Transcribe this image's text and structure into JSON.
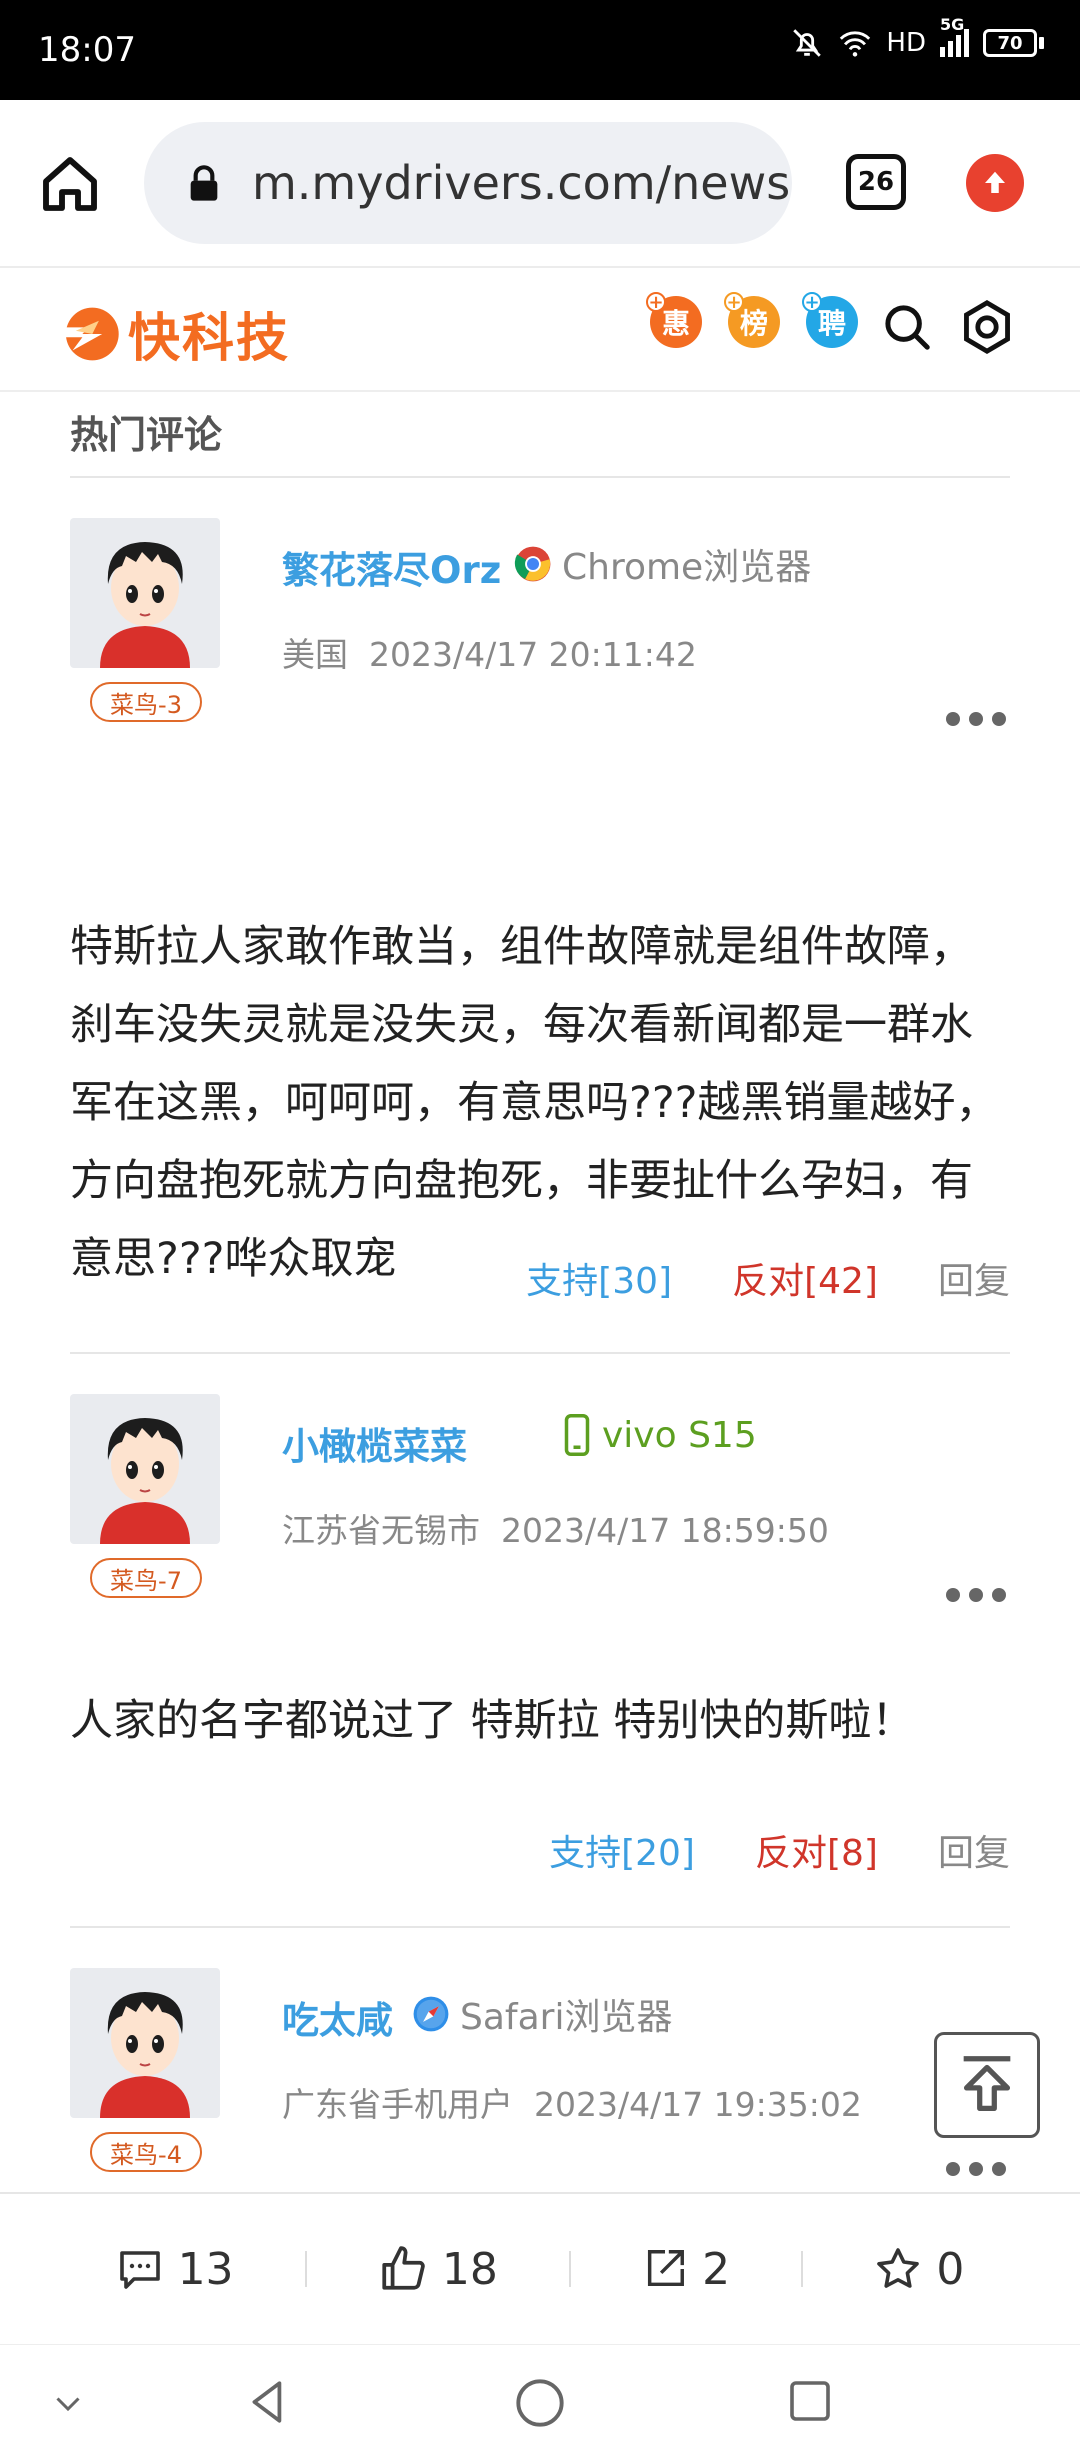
{
  "status_bar": {
    "time": "18:07",
    "network": "HD",
    "signal": "5G",
    "battery": "70"
  },
  "browser": {
    "url": "m.mydrivers.com/newsv",
    "tab_count": "26"
  },
  "site": {
    "logo_text": "快科技",
    "header_icons": [
      {
        "label": "惠",
        "color": "#f36c21",
        "icon": "deals-icon"
      },
      {
        "label": "榜",
        "color": "#f59a23",
        "icon": "ranking-icon"
      },
      {
        "label": "聘",
        "color": "#23a7e6",
        "icon": "jobs-icon"
      }
    ]
  },
  "section_title": "热门评论",
  "comments": [
    {
      "username": "繁花落尽Orz",
      "device": "Chrome浏览器",
      "device_icon": "chrome-icon",
      "location": "美国",
      "time": "2023/4/17 20:11:42",
      "level": "菜鸟-3",
      "text": "特斯拉人家敢作敢当，组件故障就是组件故障，刹车没失灵就是没失灵，每次看新闻都是一群水军在这黑，呵呵呵，有意思吗???越黑销量越好，方向盘抱死就方向盘抱死，非要扯什么孕妇，有意思???哗众取宠",
      "support": "支持[30]",
      "oppose": "反对[42]",
      "reply": "回复"
    },
    {
      "username": "小橄榄菜菜",
      "device": "vivo S15",
      "device_icon": "phone-icon",
      "location": "江苏省无锡市",
      "time": "2023/4/17 18:59:50",
      "level": "菜鸟-7",
      "text": "人家的名字都说过了 特斯拉 特别快的斯啦！",
      "support": "支持[20]",
      "oppose": "反对[8]",
      "reply": "回复"
    },
    {
      "username": "吃太咸",
      "device": "Safari浏览器",
      "device_icon": "safari-icon",
      "location": "广东省手机用户",
      "time": "2023/4/17 19:35:02",
      "level": "菜鸟-4"
    }
  ],
  "bottom_bar": {
    "comments": "13",
    "likes": "18",
    "shares": "2",
    "favorites": "0"
  },
  "colors": {
    "brand": "#f36c21",
    "username": "#3c9ee0",
    "support": "#3c9ee0",
    "oppose": "#d0352a"
  }
}
